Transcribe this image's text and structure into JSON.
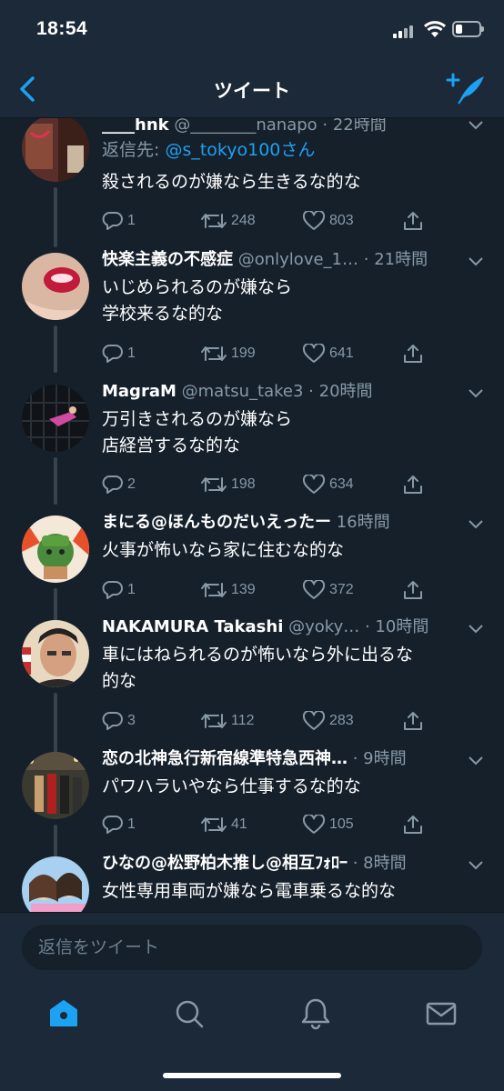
{
  "status_bar": {
    "time": "18:54"
  },
  "nav": {
    "title": "ツイート"
  },
  "colors": {
    "accent": "#1da1f2",
    "background": "#15202b",
    "bar": "#1c2938",
    "muted": "#8899a6"
  },
  "tweets": [
    {
      "name": "____hnk",
      "handle": "@________nanapo",
      "time": "· 22時間",
      "reply_to_label": "返信先:",
      "reply_to_mention": "@s_tokyo100さん",
      "text": [
        "殺されるのが嫌なら生きるな的な"
      ],
      "replies": "1",
      "retweets": "248",
      "likes": "803"
    },
    {
      "name": "快楽主義の不感症",
      "handle": "@onlylove_1…",
      "time": "· 21時間",
      "text": [
        "いじめられるのが嫌なら",
        "学校来るな的な"
      ],
      "replies": "1",
      "retweets": "199",
      "likes": "641"
    },
    {
      "name": "MagraM",
      "handle": "@matsu_take3",
      "time": "· 20時間",
      "text": [
        "万引きされるのが嫌なら",
        "店経営するな的な"
      ],
      "replies": "2",
      "retweets": "198",
      "likes": "634"
    },
    {
      "name": "まにる@ほんものだいえったー",
      "handle": "",
      "time": "16時間",
      "text": [
        "火事が怖いなら家に住むな的な"
      ],
      "replies": "1",
      "retweets": "139",
      "likes": "372"
    },
    {
      "name": "NAKAMURA Takashi",
      "handle": "@yoky…",
      "time": "· 10時間",
      "text": [
        "車にはねられるのが怖いなら外に出るな",
        "的な"
      ],
      "replies": "3",
      "retweets": "112",
      "likes": "283"
    },
    {
      "name": "恋の北神急行新宿線準特急西神…",
      "handle": "",
      "time": "· 9時間",
      "text": [
        "パワハラいやなら仕事するな的な"
      ],
      "replies": "1",
      "retweets": "41",
      "likes": "105"
    },
    {
      "name": "ひなの@松野柏木推し@相互ﾌｫﾛｰ",
      "handle": "",
      "time": "· 8時間",
      "text": [
        "女性専用車両が嫌なら電車乗るな的な"
      ]
    }
  ],
  "reply_bar": {
    "placeholder": "返信をツイート"
  },
  "tabs": [
    {
      "icon": "home-icon"
    },
    {
      "icon": "search-icon"
    },
    {
      "icon": "bell-icon"
    },
    {
      "icon": "mail-icon"
    }
  ]
}
